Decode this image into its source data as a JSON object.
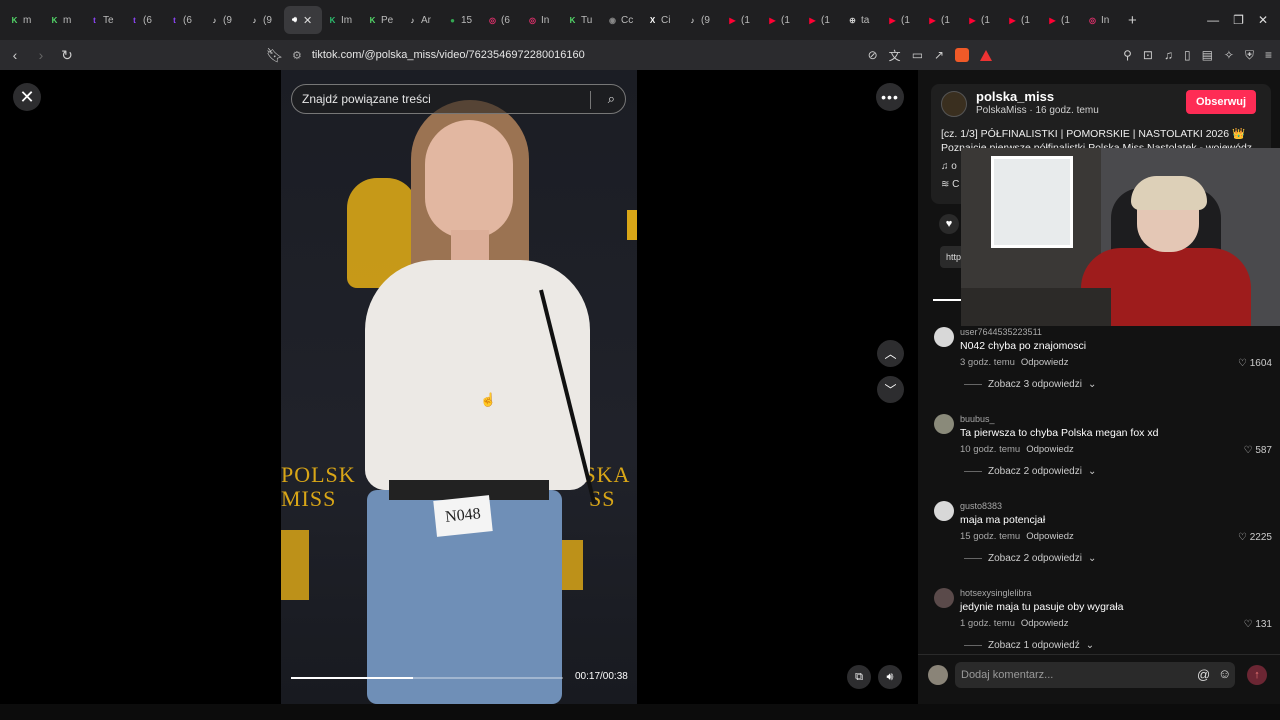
{
  "browser": {
    "tabs": [
      {
        "label": "m",
        "color": "#53d769",
        "glyph": "K"
      },
      {
        "label": "m",
        "color": "#53d769",
        "glyph": "K"
      },
      {
        "label": "Te",
        "color": "#9146ff",
        "glyph": "t"
      },
      {
        "label": "(6",
        "color": "#9146ff",
        "glyph": "t"
      },
      {
        "label": "(6",
        "color": "#9146ff",
        "glyph": "t"
      },
      {
        "label": "(9",
        "color": "#ffffff",
        "glyph": "♪"
      },
      {
        "label": "(9",
        "color": "#ffffff",
        "glyph": "♪"
      },
      {
        "label": "Im",
        "color": "#2dbd6e",
        "glyph": "K"
      },
      {
        "label": "Pe",
        "color": "#53d769",
        "glyph": "K"
      },
      {
        "label": "Ar",
        "color": "#ffffff",
        "glyph": "♪"
      },
      {
        "label": "15",
        "color": "#34a853",
        "glyph": "●"
      },
      {
        "label": "(6",
        "color": "#e1306c",
        "glyph": "◎"
      },
      {
        "label": "In",
        "color": "#e1306c",
        "glyph": "◎"
      },
      {
        "label": "Tu",
        "color": "#53d769",
        "glyph": "K"
      },
      {
        "label": "Cc",
        "color": "#888888",
        "glyph": "◉"
      },
      {
        "label": "Ci",
        "color": "#ffffff",
        "glyph": "X"
      },
      {
        "label": "(9",
        "color": "#ffffff",
        "glyph": "♪"
      },
      {
        "label": "(1",
        "color": "#ff0033",
        "glyph": "▶"
      },
      {
        "label": "(1",
        "color": "#ff0033",
        "glyph": "▶"
      },
      {
        "label": "(1",
        "color": "#ff0033",
        "glyph": "▶"
      },
      {
        "label": "ta",
        "color": "#cccccc",
        "glyph": "⊕"
      },
      {
        "label": "(1",
        "color": "#ff0033",
        "glyph": "▶"
      },
      {
        "label": "(1",
        "color": "#ff0033",
        "glyph": "▶"
      },
      {
        "label": "(1",
        "color": "#ff0033",
        "glyph": "▶"
      },
      {
        "label": "(1",
        "color": "#ff0033",
        "glyph": "▶"
      },
      {
        "label": "(1",
        "color": "#ff0033",
        "glyph": "▶"
      },
      {
        "label": "In",
        "color": "#e1306c",
        "glyph": "◎"
      }
    ],
    "url": "tiktok.com/@polska_miss/video/7623546972280016160"
  },
  "video": {
    "search_placeholder": "Znajdź powiązane treści",
    "poster_left_1": "POLSK",
    "poster_left_2": "MISS",
    "poster_right_1": "LSKA",
    "poster_right_2": "SS",
    "number_tag": "N048",
    "time": "00:17/00:38",
    "progress": 0.45
  },
  "author": {
    "username": "polska_miss",
    "meta": "PolskaMiss · 16 godz. temu",
    "follow_label": "Obserwuj",
    "caption": "[cz. 1/3] PÓŁFINALISTKI | POMORSKIE | NASTOLATKI 2026 👑 Poznajcie pierwsze półfinalistki Polska Miss Nastolatek - wojewódz",
    "music": "♫ o",
    "extra": "≋ C",
    "link": "http"
  },
  "comments": [
    {
      "user": "user7644535223511",
      "text": "N042 chyba po znajomosci",
      "time": "3 godz. temu",
      "reply": "Odpowiedz",
      "likes": "1604",
      "more": "Zobacz 3 odpowiedzi",
      "avatar": "#d8d8d8"
    },
    {
      "user": "buubus_",
      "text": "Ta pierwsza to chyba Polska megan fox xd",
      "time": "10 godz. temu",
      "reply": "Odpowiedz",
      "likes": "587",
      "more": "Zobacz 2 odpowiedzi",
      "avatar": "#8a8a7a"
    },
    {
      "user": "gusto8383",
      "text": "maja ma potencjał",
      "time": "15 godz. temu",
      "reply": "Odpowiedz",
      "likes": "2225",
      "more": "Zobacz 2 odpowiedzi",
      "avatar": "#d8d8d8"
    },
    {
      "user": "hotsexysinglelibra",
      "text": "jedynie maja tu pasuje oby wygrała",
      "time": "1 godz. temu",
      "reply": "Odpowiedz",
      "likes": "131",
      "more": "Zobacz 1 odpowiedź",
      "avatar": "#5a4a4a"
    }
  ],
  "input": {
    "placeholder": "Dodaj komentarz..."
  },
  "colors": {
    "follow": "#fe2c55",
    "gold": "#d9a617"
  }
}
